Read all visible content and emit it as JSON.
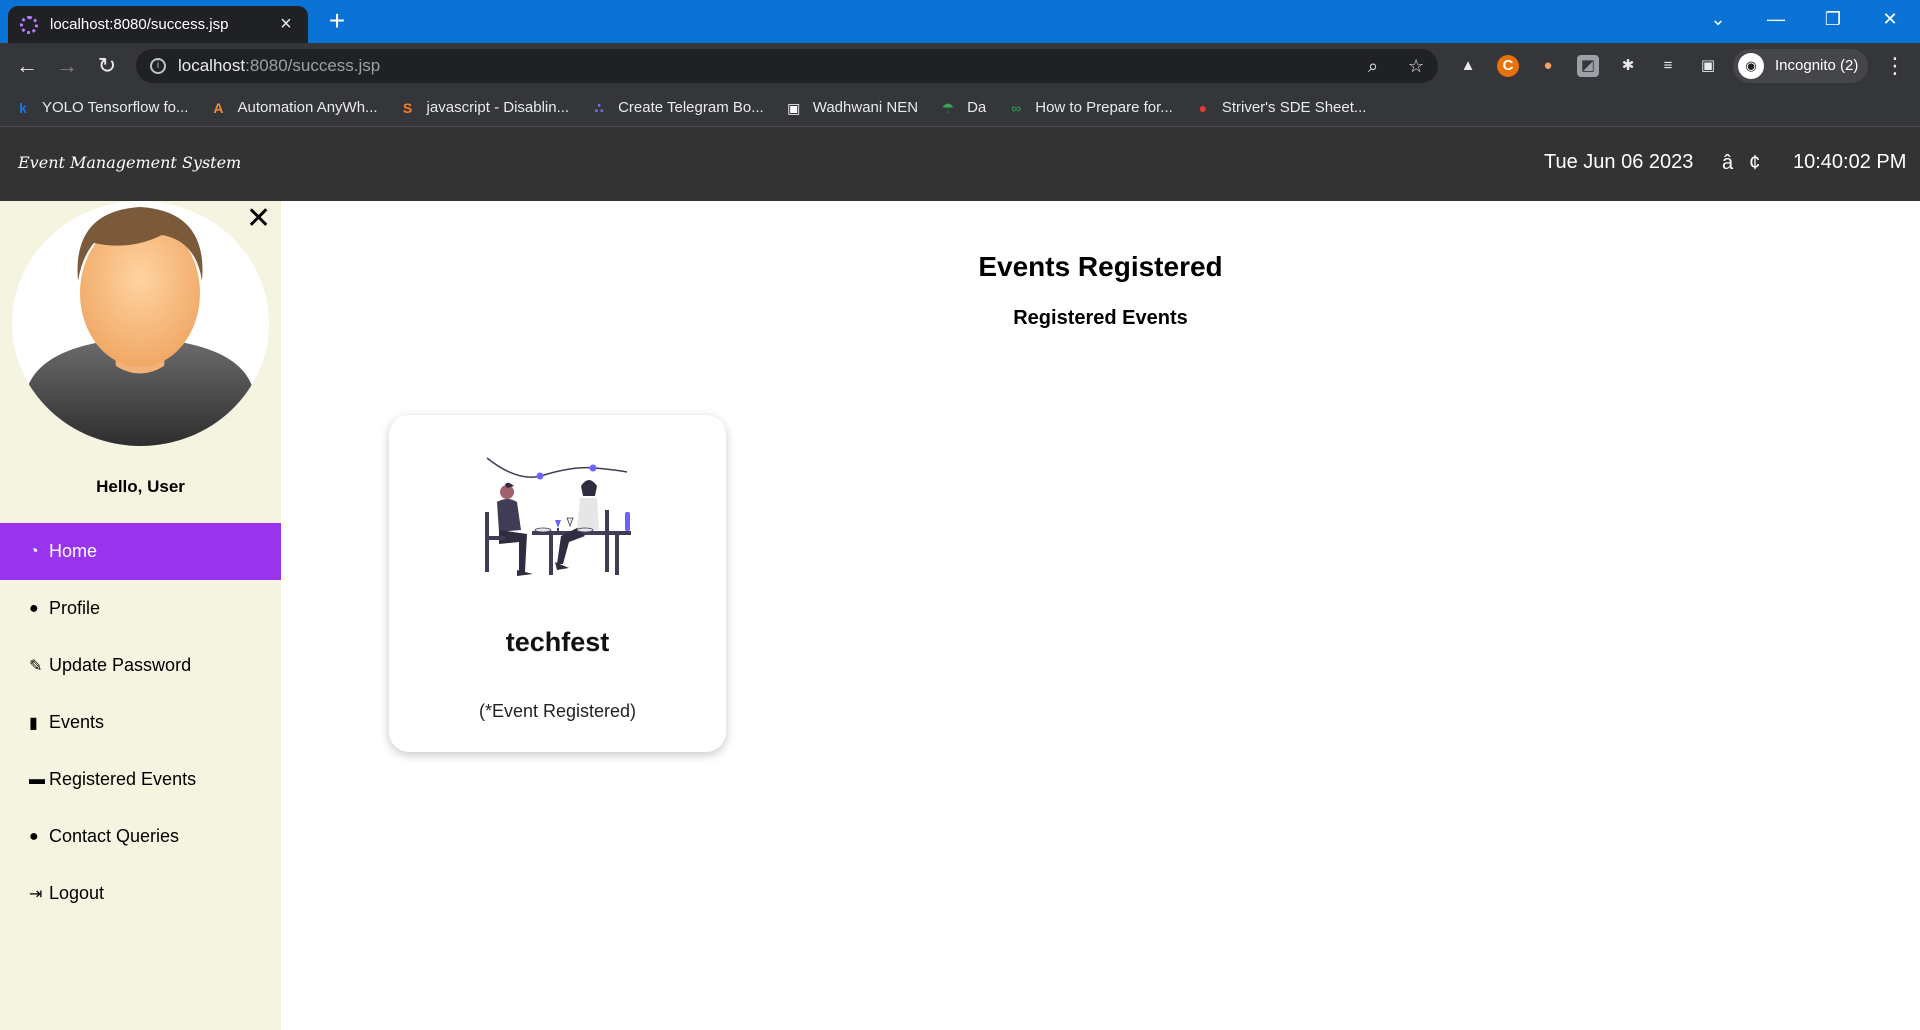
{
  "browser": {
    "tab_title": "localhost:8080/success.jsp",
    "url_host": "localhost",
    "url_path": ":8080/success.jsp",
    "profile_label": "Incognito (2)",
    "bookmarks": [
      {
        "label": "YOLO Tensorflow fo...",
        "icon": "k",
        "color": "#1a73e8"
      },
      {
        "label": "Automation AnyWh...",
        "icon": "A",
        "color": "#f28b30"
      },
      {
        "label": "javascript - Disablin...",
        "icon": "S",
        "color": "#f48024"
      },
      {
        "label": "Create Telegram Bo...",
        "icon": "∴",
        "color": "#7c6ce0"
      },
      {
        "label": "Wadhwani NEN",
        "icon": "▣",
        "color": "#ffffff"
      },
      {
        "label": "Da",
        "icon": "☂",
        "color": "#34a853"
      },
      {
        "label": "How to Prepare for...",
        "icon": "∞",
        "color": "#2f8d46"
      },
      {
        "label": "Striver's SDE Sheet...",
        "icon": "●",
        "color": "#e53935"
      }
    ]
  },
  "header": {
    "brand": "Event Management System",
    "date": "Tue Jun 06 2023",
    "glyph": "â¢",
    "time": "10:40:02 PM"
  },
  "sidebar": {
    "greeting": "Hello, User",
    "items": [
      {
        "label": "Home",
        "icon": "dashboard-icon",
        "active": true
      },
      {
        "label": "Profile",
        "icon": "user-icon",
        "active": false
      },
      {
        "label": "Update Password",
        "icon": "edit-icon",
        "active": false
      },
      {
        "label": "Events",
        "icon": "book-icon",
        "active": false
      },
      {
        "label": "Registered Events",
        "icon": "credit-card-icon",
        "active": false
      },
      {
        "label": "Contact Queries",
        "icon": "comments-icon",
        "active": false
      },
      {
        "label": "Logout",
        "icon": "logout-icon",
        "active": false
      }
    ]
  },
  "main": {
    "title": "Events Registered",
    "subtitle": "Registered Events",
    "cards": [
      {
        "name": "techfest",
        "status": "(*Event Registered)"
      }
    ]
  },
  "colors": {
    "accent": "#9933ee",
    "header_bg": "#333333",
    "sidebar_bg": "#f4f4e0"
  }
}
